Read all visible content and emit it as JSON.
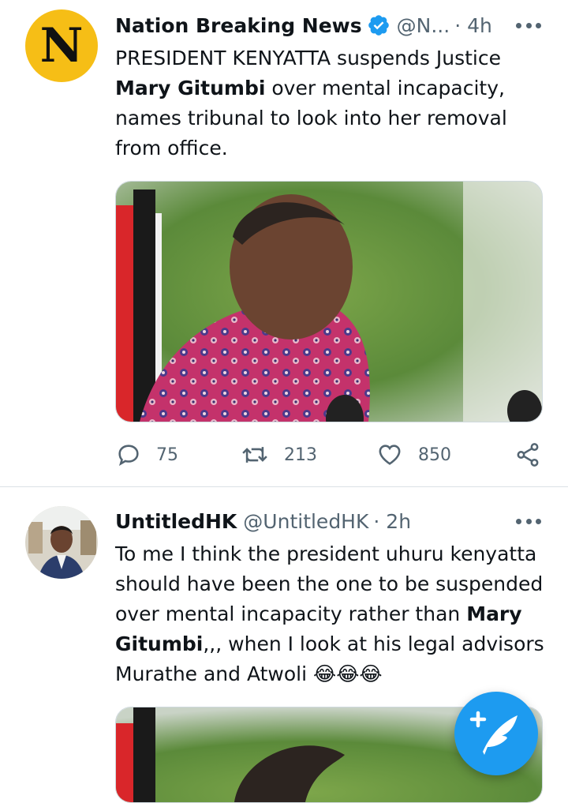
{
  "tweet1": {
    "name": "Nation Breaking News",
    "handle": "@N...",
    "time": "· 4h",
    "avatar_letter": "N",
    "text_pre": "PRESIDENT KENYATTA suspends Justice ",
    "text_bold": "Mary Gitumbi",
    "text_post": " over mental incapacity, names tribunal to look into her removal from office.",
    "replies": "75",
    "retweets": "213",
    "likes": "850"
  },
  "tweet2": {
    "name": "UntitledHK",
    "handle": "@UntitledHK",
    "time": "· 2h",
    "text_pre": "To me I think the president uhuru kenyatta should have been the one to be suspended over mental incapacity rather than ",
    "text_bold": "Mary Gitumbi",
    "text_post": ",,, when I look at his legal  advisors Murathe and Atwoli 😂😂😂"
  },
  "colors": {
    "accent": "#1d9bf0",
    "logo_bg": "#f6be16",
    "muted": "#536471"
  }
}
